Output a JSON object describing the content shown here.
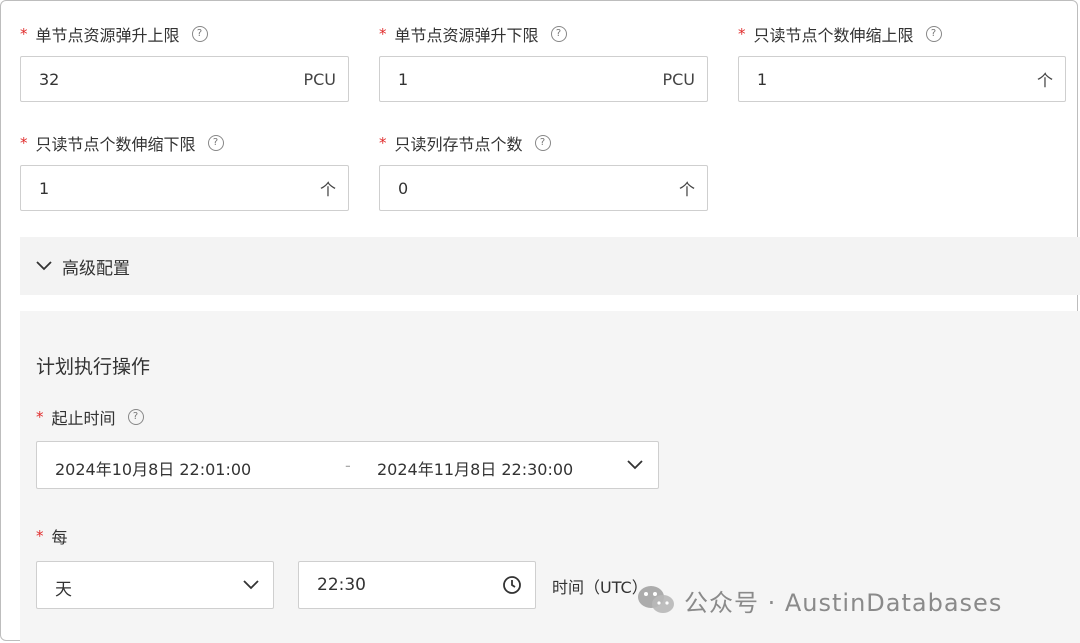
{
  "row1": {
    "max_res": {
      "label": "单节点资源弹升上限",
      "value": "32",
      "unit": "PCU"
    },
    "min_res": {
      "label": "单节点资源弹升下限",
      "value": "1",
      "unit": "PCU"
    },
    "ro_max": {
      "label": "只读节点个数伸缩上限",
      "value": "1",
      "unit": "个"
    }
  },
  "row2": {
    "ro_min": {
      "label": "只读节点个数伸缩下限",
      "value": "1",
      "unit": "个"
    },
    "ro_col": {
      "label": "只读列存节点个数",
      "value": "0",
      "unit": "个"
    }
  },
  "advanced": {
    "label": "高级配置"
  },
  "plan": {
    "title": "计划执行操作",
    "time_range": {
      "label": "起止时间",
      "start": "2024年10月8日 22:01:00",
      "sep": "-",
      "end": "2024年11月8日 22:30:00"
    },
    "every": {
      "label": "每",
      "period": "天",
      "time": "22:30",
      "time_suffix": "时间（UTC）"
    }
  },
  "help_glyph": "?",
  "required_mark": "*",
  "watermark": "公众号 · AustinDatabases"
}
